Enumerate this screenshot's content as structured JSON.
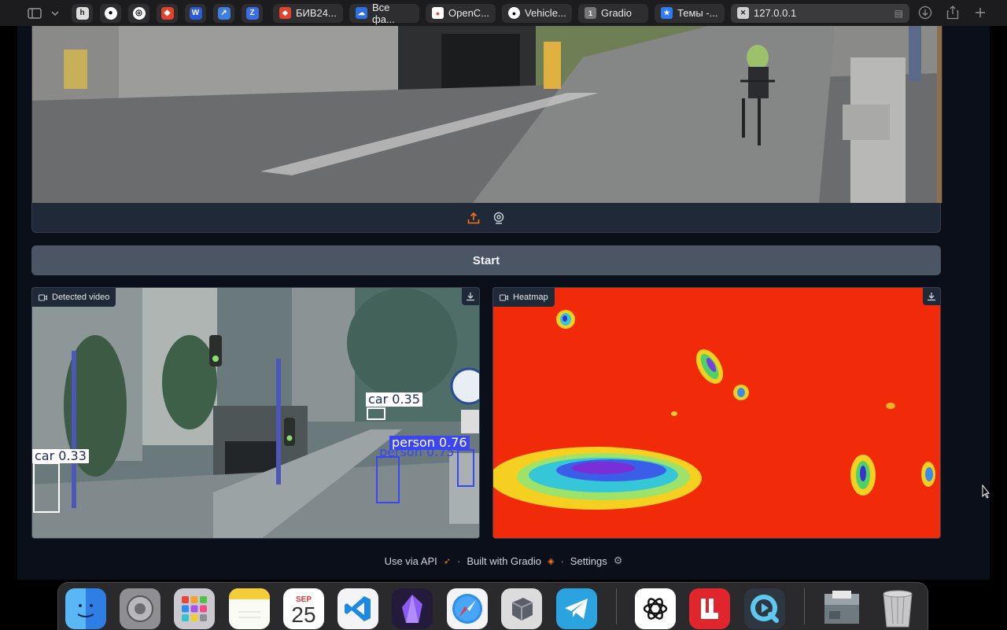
{
  "browser": {
    "tabs": [
      {
        "label": "БИВ24...",
        "icon": "gitlab-icon",
        "color": "#e2432a"
      },
      {
        "label": "Все фа...",
        "icon": "cloud-icon",
        "color": "#2f6fe4"
      },
      {
        "label": "OpenC...",
        "icon": "opencv-icon",
        "color": "#e94b35"
      },
      {
        "label": "Vehicle...",
        "icon": "github-icon",
        "color": "#f0f0f0"
      },
      {
        "label": "Gradio",
        "icon": "gradio-icon",
        "badge": "1",
        "color": "#888888"
      },
      {
        "label": "Темы -...",
        "icon": "star-icon",
        "color": "#2d7cf6"
      },
      {
        "label": "127.0.0.1",
        "icon": "close-icon",
        "color": "#d0d0d0",
        "active": true
      }
    ]
  },
  "outputs": {
    "detected": {
      "label": "Detected video",
      "detections": [
        {
          "text": "car 0.35",
          "color": "#ffffff"
        },
        {
          "text": "person 0.76",
          "color": "#3b46f2"
        },
        {
          "text": "person 0.75",
          "color": "#3b46f2"
        },
        {
          "text": "car 0.33",
          "color": "#ffffff"
        }
      ]
    },
    "heatmap": {
      "label": "Heatmap",
      "background": "#f12b0a"
    }
  },
  "controls": {
    "start_label": "Start"
  },
  "footer": {
    "api": "Use via API",
    "built": "Built with Gradio",
    "settings": "Settings",
    "separator": "·"
  },
  "dock": {
    "calendar_month": "SEP",
    "calendar_day": "25",
    "apps": [
      "finder-icon",
      "system-settings-icon",
      "launchpad-icon",
      "notes-icon",
      "calendar-icon",
      "vscode-icon",
      "obsidian-icon",
      "safari-icon",
      "parallels-icon",
      "telegram-icon",
      "chatgpt-icon",
      "app-icon",
      "quicktime-icon",
      "downloads-stack-icon",
      "trash-icon"
    ]
  }
}
